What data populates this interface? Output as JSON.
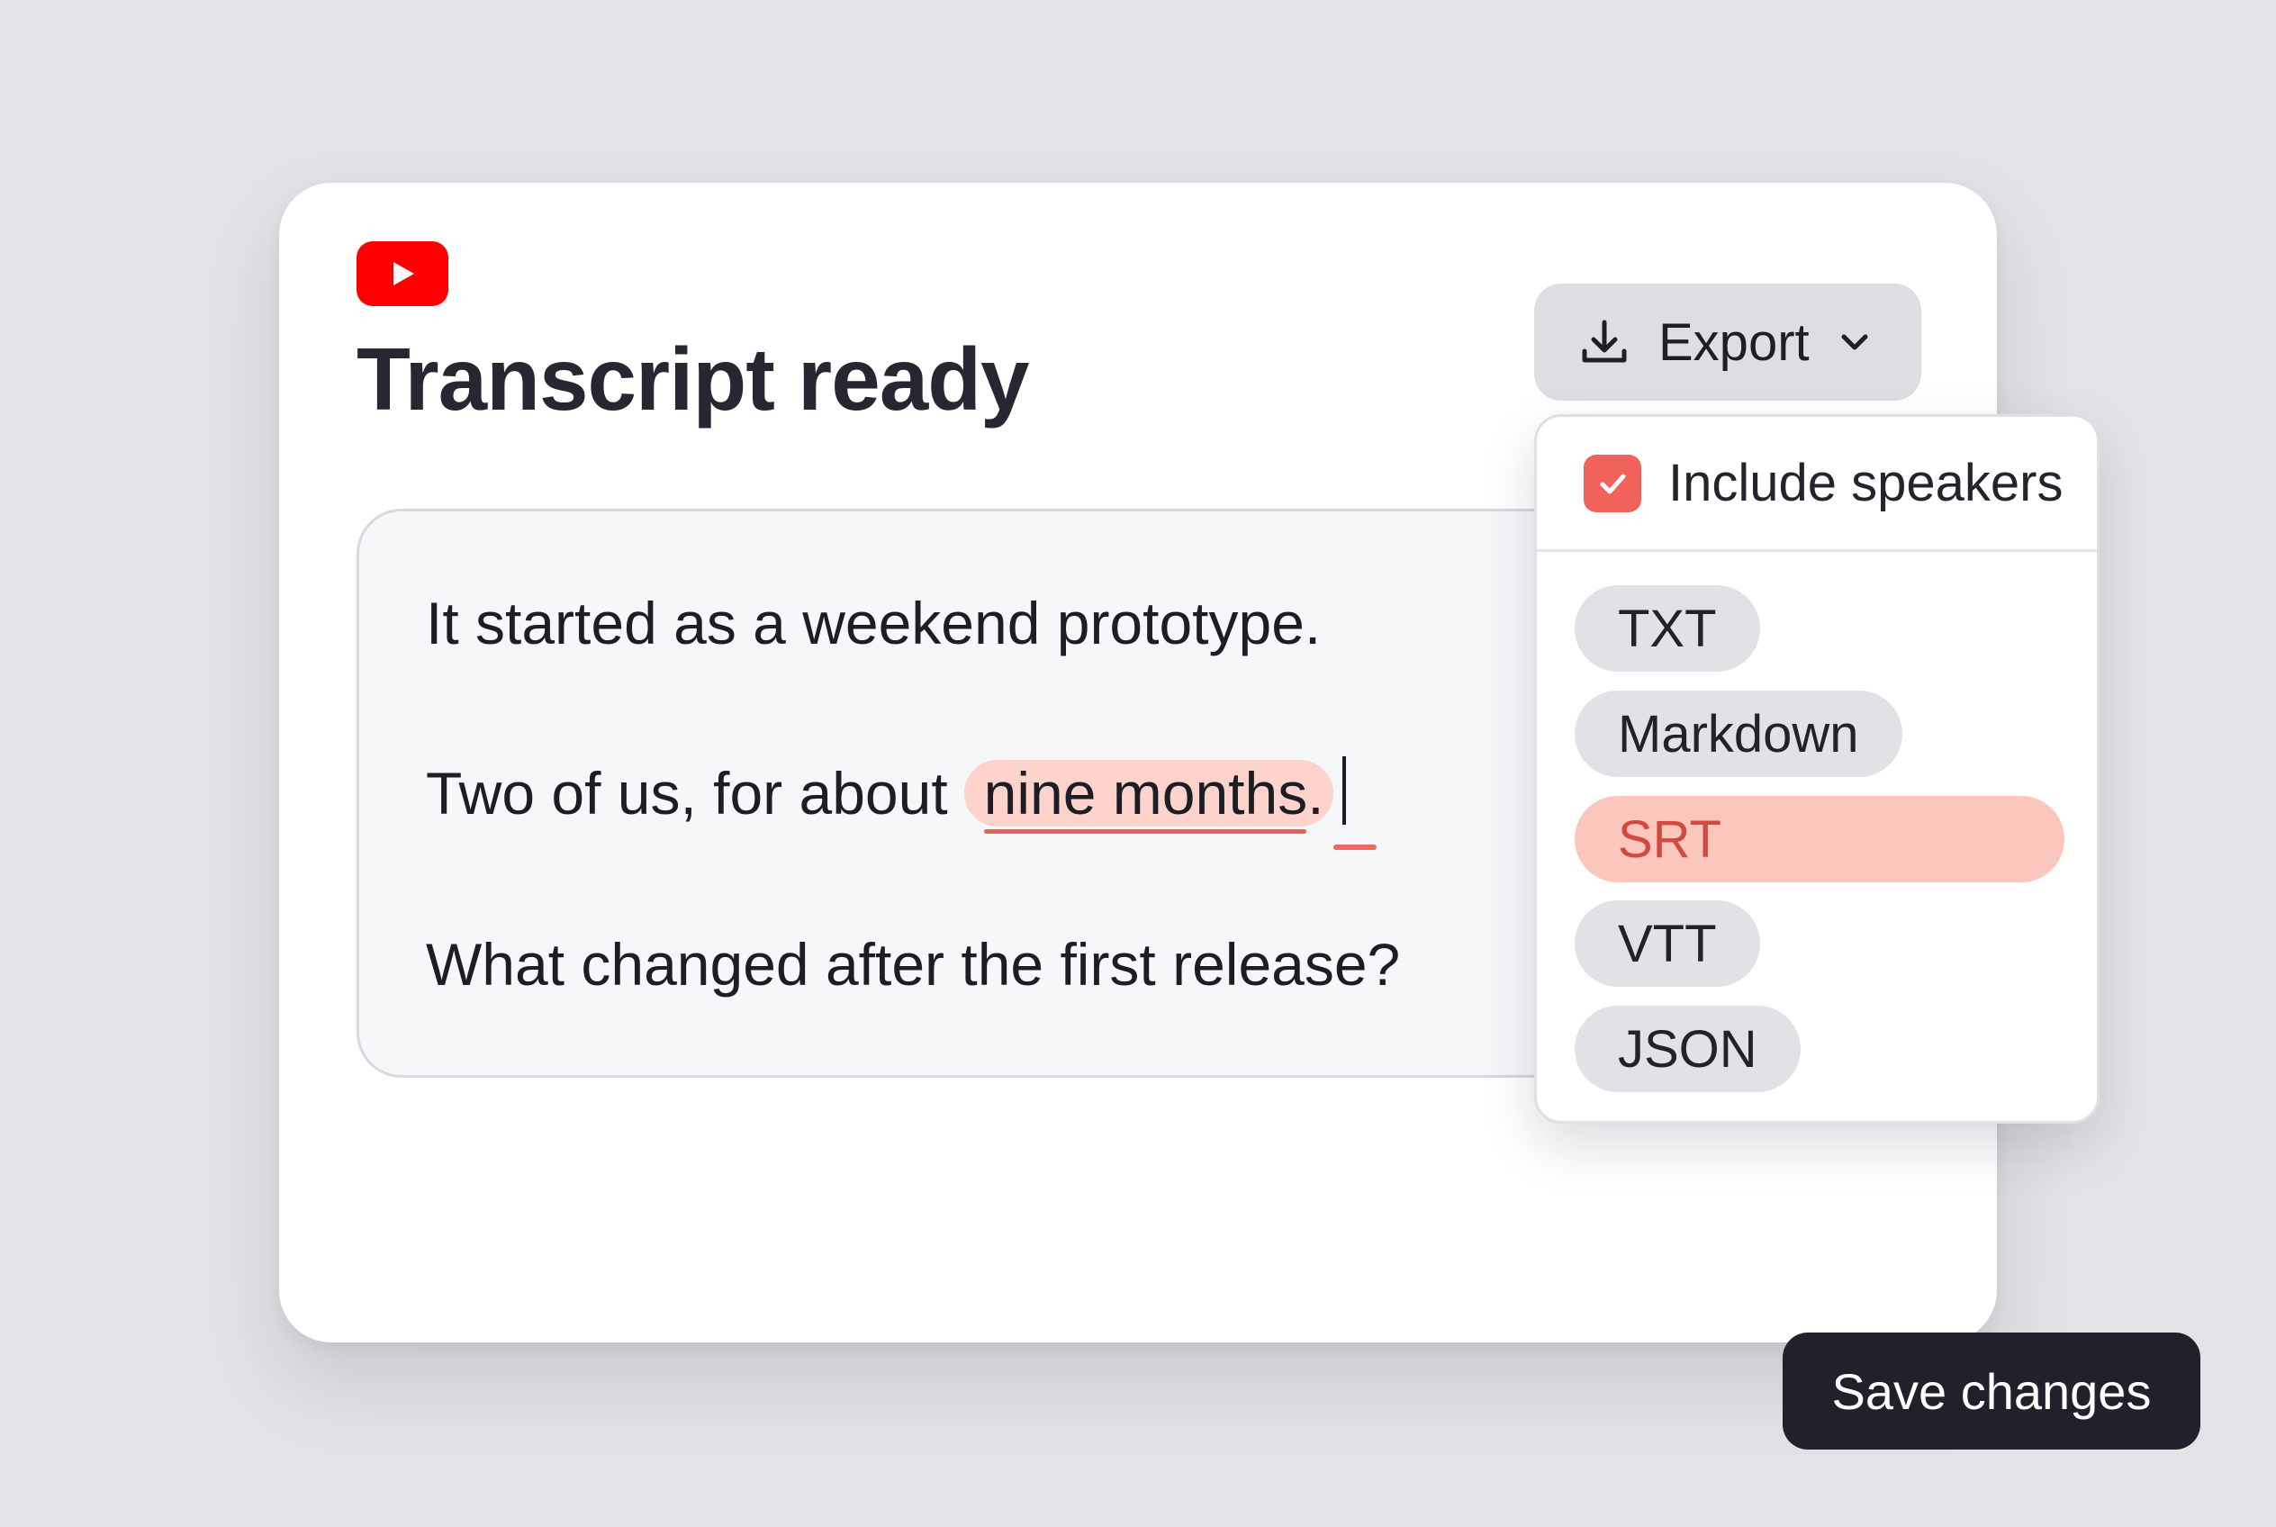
{
  "colors": {
    "background": "#e3e3e7",
    "card": "#ffffff",
    "accent": "#f0625a",
    "highlight": "#fdd3cc",
    "selected_bg": "#fbc6bb",
    "selected_text": "#d14a40",
    "brand_red": "#ff0000",
    "primary_button": "#20212b"
  },
  "app": {
    "logo_icon": "youtube-play-icon",
    "title": "Transcript ready"
  },
  "transcript": {
    "line1": "It started as a weekend prototype.",
    "line2_plain": "Two of us, for about",
    "line2_highlight": "nine months.",
    "line3": "What changed after the first release?"
  },
  "export": {
    "icon": "download-icon",
    "label": "Export",
    "chevron": "chevron-down-icon"
  },
  "dropdown": {
    "include_speakers": {
      "label": "Include speakers",
      "checked": true
    },
    "formats": [
      "TXT",
      "Markdown",
      "SRT",
      "VTT",
      "JSON"
    ],
    "selected_format": "SRT"
  },
  "footer": {
    "save_label": "Save changes"
  }
}
